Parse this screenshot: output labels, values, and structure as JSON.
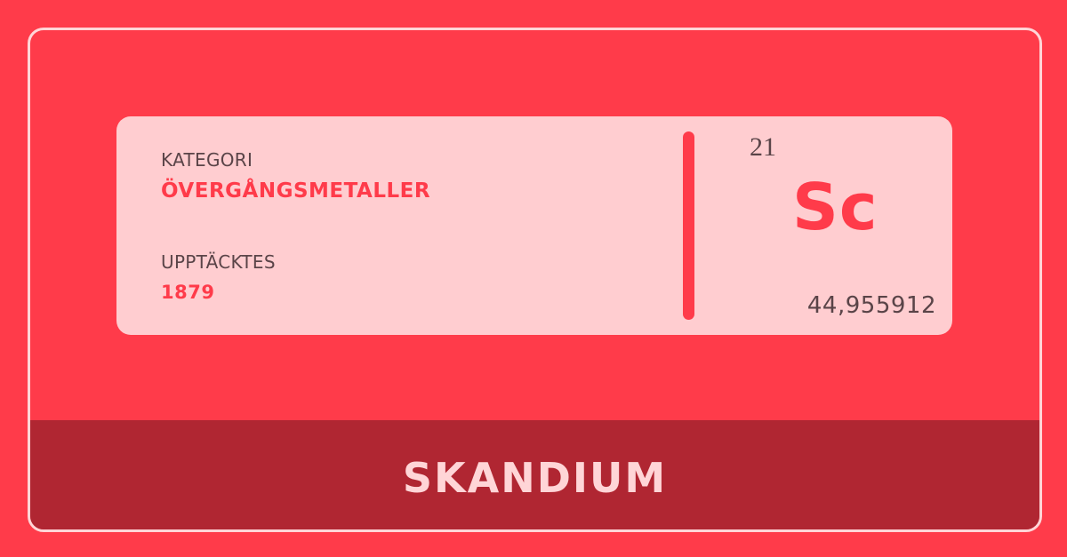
{
  "category": {
    "label": "KATEGORI",
    "value": "ÖVERGÅNGSMETALLER"
  },
  "discovered": {
    "label": "UPPTÄCKTES",
    "value": "1879"
  },
  "element": {
    "atomic_number": "21",
    "symbol": "Sc",
    "atomic_mass": "44,955912",
    "name": "SKANDIUM"
  },
  "colors": {
    "background": "#ff3b4a",
    "card": "#ffcdd0",
    "band": "#b02632",
    "accent": "#ff3b4a",
    "text": "#5a4448"
  }
}
